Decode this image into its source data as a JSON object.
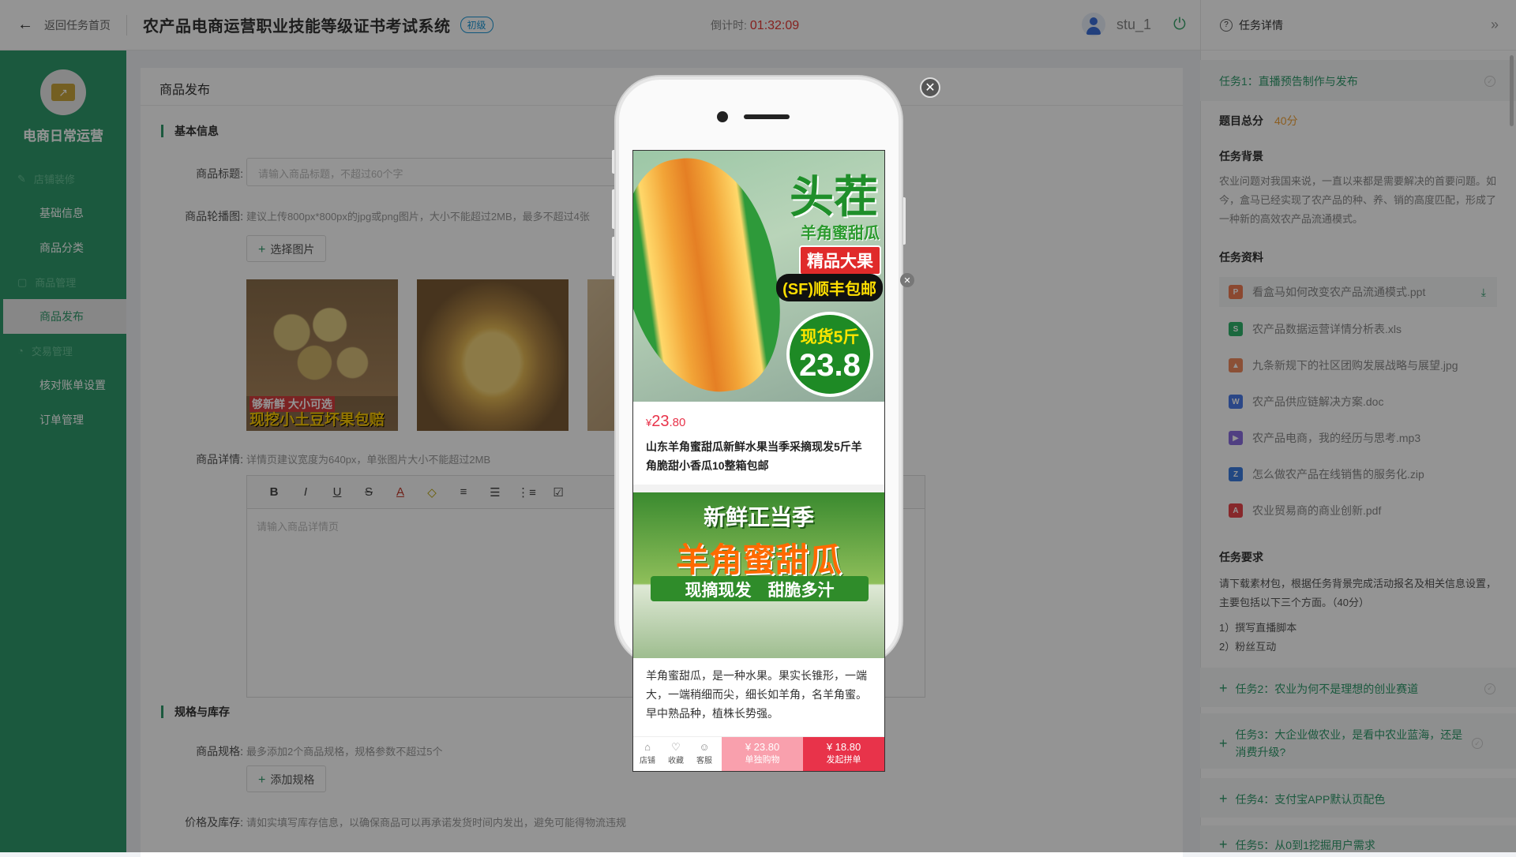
{
  "topbar": {
    "back_label": "返回任务首页",
    "system_title": "农产品电商运营职业技能等级证书考试系统",
    "level_badge": "初级",
    "timer_label": "倒计时:",
    "timer_value": "01:32:09",
    "username": "stu_1"
  },
  "sidebar": {
    "brand": "电商日常运营",
    "groups": [
      {
        "label": "店铺装修",
        "items": [
          "基础信息",
          "商品分类"
        ]
      },
      {
        "label": "商品管理",
        "items": [
          "商品发布"
        ]
      },
      {
        "label": "交易管理",
        "items": [
          "核对账单设置",
          "订单管理"
        ]
      }
    ],
    "active_item": "商品发布"
  },
  "main": {
    "page_title": "商品发布",
    "section_basic": "基本信息",
    "title_label": "商品标题:",
    "title_placeholder": "请输入商品标题，不超过60个字",
    "carousel_label": "商品轮播图:",
    "carousel_hint": "建议上传800px*800px的jpg或png图片，大小不能超过2MB，最多不超过4张",
    "select_image": "选择图片",
    "thumb1_caption1": "够新鲜 大小可选",
    "thumb1_caption2": "现挖小土豆坏果包赔",
    "detail_label": "商品详情:",
    "detail_hint": "详情页建议宽度为640px，单张图片大小不能超过2MB",
    "editor_placeholder": "请输入商品详情页",
    "toolbar": [
      "B",
      "I",
      "U",
      "S",
      "A",
      "◇",
      "≡",
      "☰",
      "⋮≡",
      "☑"
    ],
    "section_spec": "规格与库存",
    "spec_label": "商品规格:",
    "spec_hint": "最多添加2个商品规格，规格参数不超过5个",
    "add_spec": "添加规格",
    "stock_label": "价格及库存:",
    "stock_hint": "请如实填写库存信息，以确保商品可以再承诺发货时间内发出，避免可能得物流违规"
  },
  "preview": {
    "melon1_title": "头茬",
    "melon1_sub": "羊角蜜甜瓜",
    "melon1_tag": "精品大果",
    "melon1_sf": "(SF)顺丰包邮",
    "melon1_stock": "现货5斤",
    "melon1_price": "23.8",
    "price_symbol": "¥",
    "price_int": "23",
    "price_dec": ".80",
    "product_name": "山东羊角蜜甜瓜新鲜水果当季采摘现发5斤羊角脆甜小香瓜10整箱包邮",
    "melon2_line1": "新鲜正当季",
    "melon2_line2": "羊角蜜甜瓜",
    "melon2_line3": "现摘现发　甜脆多汁",
    "description": "羊角蜜甜瓜，是一种水果。果实长锥形，一端大，一端稍细而尖，细长如羊角，名羊角蜜。早中熟品种，植株长势强。",
    "bar_shop": "店铺",
    "bar_fav": "收藏",
    "bar_service": "客服",
    "buy_alone_price": "¥ 23.80",
    "buy_alone_label": "单独购物",
    "group_price": "¥ 18.80",
    "group_label": "发起拼单"
  },
  "right_panel": {
    "header": "任务详情",
    "task1": "任务1：直播预告制作与发布",
    "score_label": "题目总分",
    "score_value": "40分",
    "background_title": "任务背景",
    "background_text": "农业问题对我国来说，一直以来都是需要解决的首要问题。如今，盒马已经实现了农产品的种、养、销的高度匹配，形成了一种新的高效农产品流通模式。",
    "materials_title": "任务资料",
    "files": [
      {
        "name": "看盒马如何改变农产品流通模式.ppt",
        "color": "#f07c53",
        "icon": "P"
      },
      {
        "name": "农产品数据运营详情分析表.xls",
        "color": "#2fb36b",
        "icon": "S"
      },
      {
        "name": "九条新规下的社区团购发展战略与展望.jpg",
        "color": "#f08a5d",
        "icon": "▲"
      },
      {
        "name": "农产品供应链解决方案.doc",
        "color": "#4a7be8",
        "icon": "W"
      },
      {
        "name": "农产品电商，我的经历与思考.mp3",
        "color": "#8b6de0",
        "icon": "▶"
      },
      {
        "name": "怎么做农产品在线销售的服务化.zip",
        "color": "#3b7de0",
        "icon": "Z"
      },
      {
        "name": "农业贸易商的商业创新.pdf",
        "color": "#e8454a",
        "icon": "A"
      }
    ],
    "requirements_title": "任务要求",
    "requirements_text": "请下载素材包，根据任务背景完成活动报名及相关信息设置，主要包括以下三个方面。（40分）",
    "req_items": [
      "1）撰写直播脚本",
      "2）粉丝互动"
    ],
    "task2": "任务2：农业为何不是理想的创业赛道",
    "task3": "任务3：大企业做农业，是看中农业蓝海，还是消费升级?",
    "task4": "任务4：支付宝APP默认页配色",
    "task5": "任务5：从0到1挖掘用户需求"
  }
}
